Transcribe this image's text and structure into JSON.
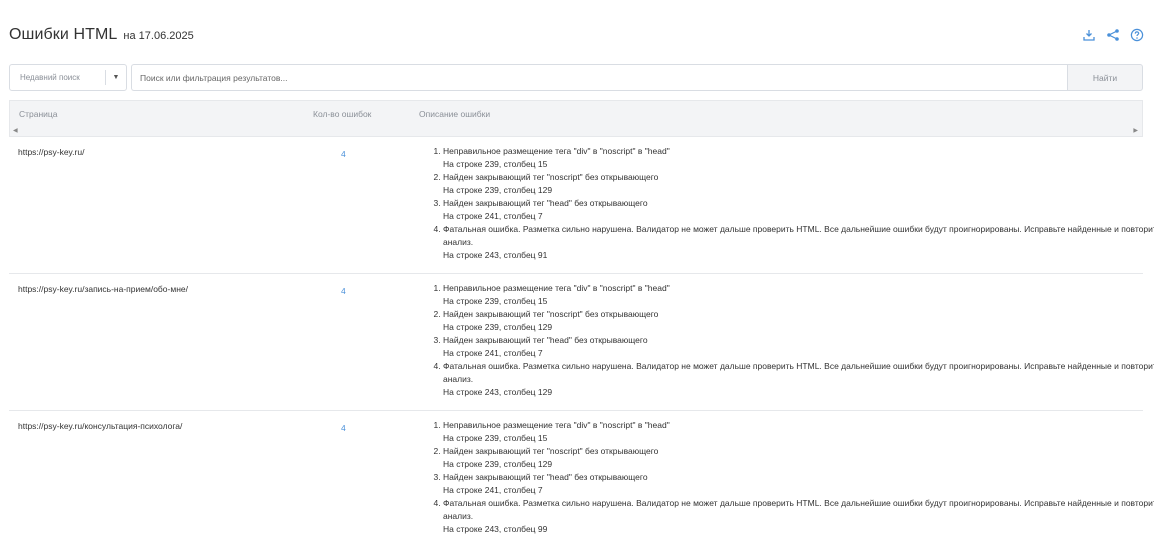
{
  "header": {
    "title": "Ошибки HTML",
    "date_label": "на 17.06.2025"
  },
  "icons": {
    "download": "download-icon",
    "share": "share-icon",
    "help": "help-icon",
    "accent": "#4a90d9"
  },
  "search": {
    "recent_label": "Недавний поиск",
    "placeholder": "Поиск или фильтрация результатов...",
    "value": "",
    "button_label": "Найти"
  },
  "table": {
    "columns": [
      "Страница",
      "Кол-во ошибок",
      "Описание ошибки"
    ],
    "rows": [
      {
        "page": "https://psy-key.ru/",
        "count": "4",
        "errors": [
          {
            "text": "Неправильное размещение тега \"div\" в \"noscript\" в \"head\"",
            "loc": "На строке 239, столбец 15"
          },
          {
            "text": "Найден закрывающий тег \"noscript\" без открывающего",
            "loc": "На строке 239, столбец 129"
          },
          {
            "text": "Найден закрывающий тег \"head\" без открывающего",
            "loc": "На строке 241, столбец 7"
          },
          {
            "text": "Фатальная ошибка. Разметка сильно нарушена. Валидатор не может дальше проверить HTML. Все дальнейшие ошибки будут проигнорированы. Исправьте найденные и повторите анализ.",
            "loc": "На строке 243, столбец 91"
          }
        ]
      },
      {
        "page": "https://psy-key.ru/запись-на-прием/обо-мне/",
        "count": "4",
        "errors": [
          {
            "text": "Неправильное размещение тега \"div\" в \"noscript\" в \"head\"",
            "loc": "На строке 239, столбец 15"
          },
          {
            "text": "Найден закрывающий тег \"noscript\" без открывающего",
            "loc": "На строке 239, столбец 129"
          },
          {
            "text": "Найден закрывающий тег \"head\" без открывающего",
            "loc": "На строке 241, столбец 7"
          },
          {
            "text": "Фатальная ошибка. Разметка сильно нарушена. Валидатор не может дальше проверить HTML. Все дальнейшие ошибки будут проигнорированы. Исправьте найденные и повторите анализ.",
            "loc": "На строке 243, столбец 129"
          }
        ]
      },
      {
        "page": "https://psy-key.ru/консультация-психолога/",
        "count": "4",
        "errors": [
          {
            "text": "Неправильное размещение тега \"div\" в \"noscript\" в \"head\"",
            "loc": "На строке 239, столбец 15"
          },
          {
            "text": "Найден закрывающий тег \"noscript\" без открывающего",
            "loc": "На строке 239, столбец 129"
          },
          {
            "text": "Найден закрывающий тег \"head\" без открывающего",
            "loc": "На строке 241, столбец 7"
          },
          {
            "text": "Фатальная ошибка. Разметка сильно нарушена. Валидатор не может дальше проверить HTML. Все дальнейшие ошибки будут проигнорированы. Исправьте найденные и повторите анализ.",
            "loc": "На строке 243, столбец 99"
          }
        ]
      }
    ]
  }
}
